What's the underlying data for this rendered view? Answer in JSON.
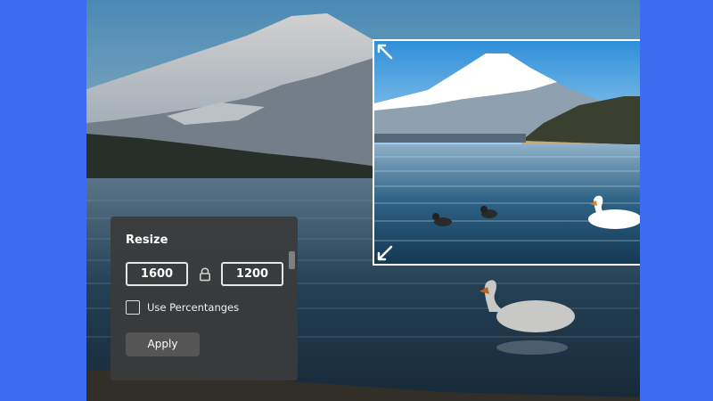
{
  "resize_panel": {
    "title": "Resize",
    "width_value": "1600",
    "height_value": "1200",
    "lock_icon": "lock-icon",
    "use_percentages_label": "Use Percentanges",
    "use_percentages_checked": false,
    "apply_label": "Apply"
  },
  "crop_box": {
    "handle_icon": "expand-arrow-icon"
  },
  "colors": {
    "background": "#3d6cf0",
    "panel": "#3a3a3a",
    "apply_button": "#555555",
    "crop_border": "#ffffff"
  }
}
